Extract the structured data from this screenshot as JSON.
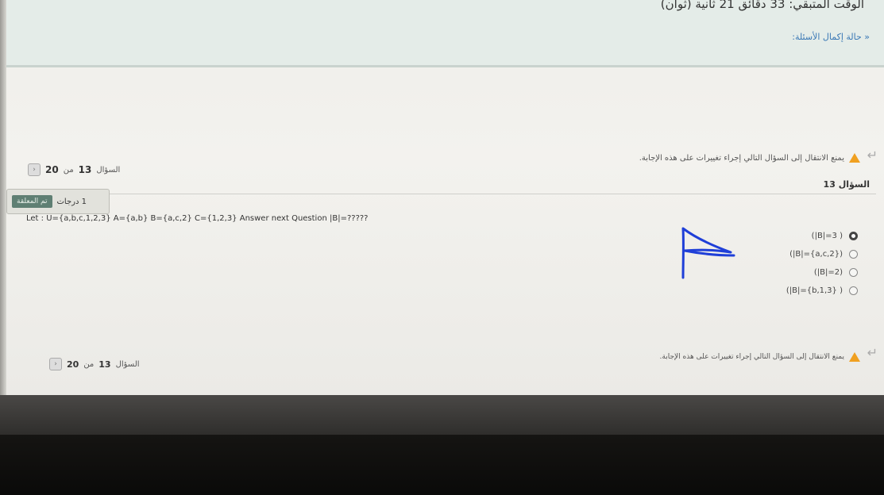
{
  "header": {
    "timer_text": "الوقت المتبقي: 33 دقائق 21 ثانية (ثوان)",
    "nav_status_link": "« حالة إكمال الأسئلة:"
  },
  "navigation": {
    "warning_text": "يمنع الانتقال إلى السؤال التالي إجراء تغييرات على هذه الإجابة.",
    "counter_prefix": "السؤال",
    "current": "13",
    "of_label": "من",
    "total": "20"
  },
  "question": {
    "title": "السؤال 13",
    "grade_label": "1 درجات",
    "flag_label": "تم المعلقة",
    "text": "Let : U={a,b,c,1,2,3} A={a,b} B={a,c,2} C={1,2,3} Answer next Question |B|=?????",
    "answers": [
      {
        "label": "(|B|=3 )",
        "selected": true
      },
      {
        "label": "(|B|={a,c,2})",
        "selected": false
      },
      {
        "label": "(|B|=2)",
        "selected": false
      },
      {
        "label": "(|B|={b,1,3} )",
        "selected": false
      }
    ]
  },
  "annotation": {
    "handwritten_mark": "A"
  },
  "colors": {
    "accent_link": "#3a78b5",
    "warning": "#f0a020",
    "flag_button": "#5f7f73",
    "ink": "#1f3fd8"
  },
  "icons": {
    "warning": "warning-icon",
    "return": "return-arrow-icon",
    "prev": "chevron-left-icon"
  }
}
